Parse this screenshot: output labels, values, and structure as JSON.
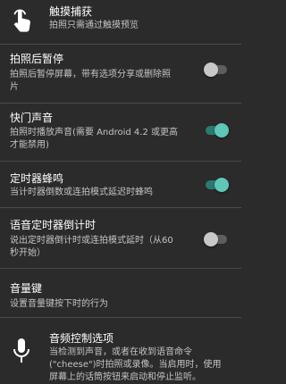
{
  "colors": {
    "background": "#2b2b2b",
    "divider": "#4a4a4a",
    "title": "#ffffff",
    "summary": "#c4c4c4",
    "accent_on": "#5fc7b8",
    "toggle_off": "#c8c8c8"
  },
  "items": [
    {
      "icon": "touch-icon",
      "title": "触摸捕获",
      "summary": "拍照只需通过触摸预览"
    },
    {
      "title": "拍照后暂停",
      "summary_line1": "拍照后暂停屏幕，带有选项分享或删除照",
      "summary_line2": "片",
      "switch": "off"
    },
    {
      "title": "快门声音",
      "summary_line1": "拍照时播放声音(需要 Android 4.2 或更高",
      "summary_line2": "才能禁用)",
      "switch": "on"
    },
    {
      "title": "定时器蜂鸣",
      "summary": "当计时器倒数或连拍模式延迟时蜂鸣",
      "switch": "on"
    },
    {
      "title": "语音定时器倒计时",
      "summary_line1": "说出定时器倒计时或连拍模式延时（从60",
      "summary_line2": "秒开始）",
      "switch": "off"
    },
    {
      "title": "音量键",
      "summary": "设置音量键按下时的行为"
    },
    {
      "icon": "microphone-icon",
      "title": "音频控制选项",
      "summary_line1": "当检测到声音，或者在收到语音命令",
      "summary_line2": "(\"cheese\")时拍照或录像。当启用时，使用",
      "summary_line3": "屏幕上的话筒按钮来启动和停止监听。"
    }
  ]
}
